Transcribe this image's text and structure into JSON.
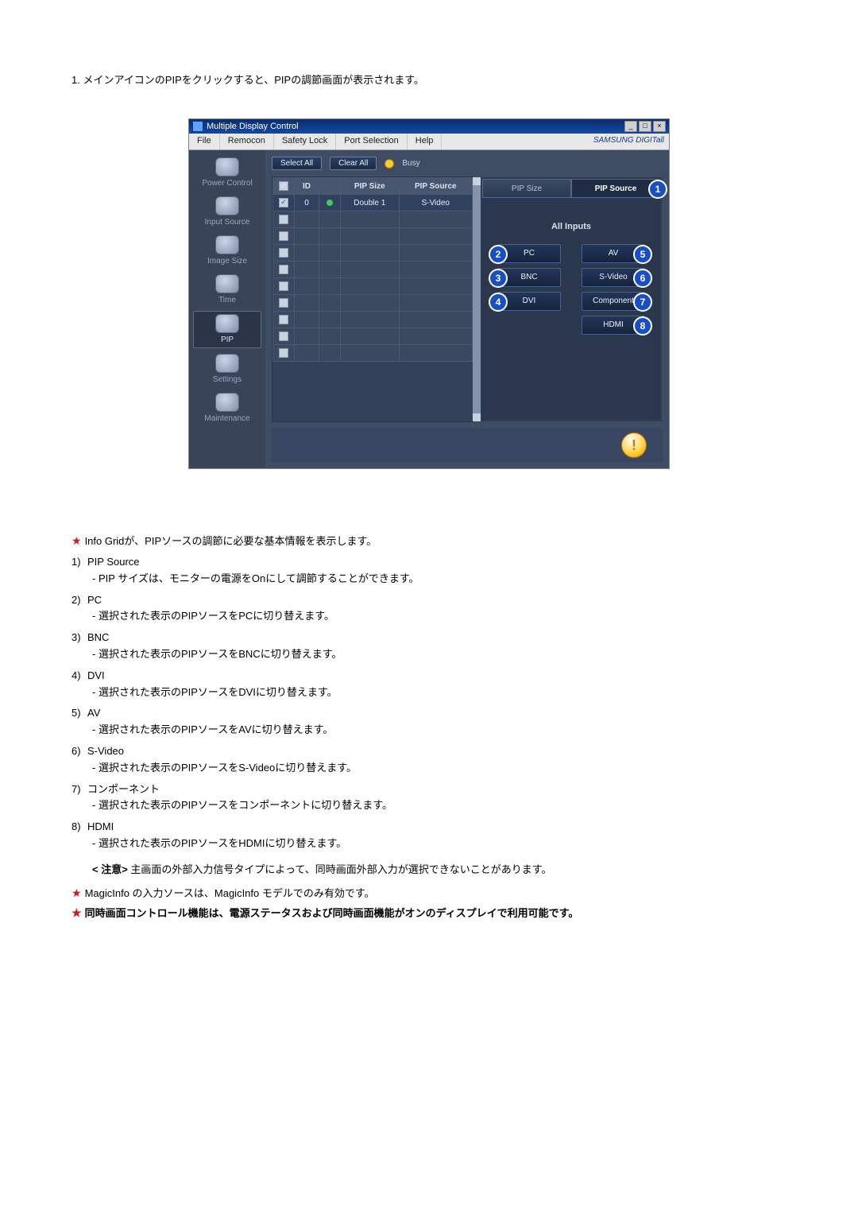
{
  "intro": "1.  メインアイコンのPIPをクリックすると、PIPの調節画面が表示されます。",
  "window": {
    "title": "Multiple Display Control",
    "menu": [
      "File",
      "Remocon",
      "Safety Lock",
      "Port Selection",
      "Help"
    ],
    "brand": "SAMSUNG DIGITall",
    "sidebar": [
      {
        "label": "Power Control"
      },
      {
        "label": "Input Source"
      },
      {
        "label": "Image Size"
      },
      {
        "label": "Time"
      },
      {
        "label": "PIP",
        "active": true
      },
      {
        "label": "Settings"
      },
      {
        "label": "Maintenance"
      }
    ],
    "toolbar": {
      "select_all": "Select All",
      "clear_all": "Clear All",
      "busy": "Busy"
    },
    "grid": {
      "headers": {
        "sel": "",
        "id": "ID",
        "status": "",
        "pip_size": "PIP Size",
        "pip_source": "PIP Source"
      },
      "rows": [
        {
          "id": "0",
          "pip_size": "Double 1",
          "pip_source": "S-Video",
          "active": true
        }
      ],
      "blank_rows": 9
    },
    "panel": {
      "tabs": [
        {
          "label": "PIP Size",
          "callout": null
        },
        {
          "label": "PIP Source",
          "callout": "1",
          "active": true
        }
      ],
      "heading": "All Inputs",
      "left_col": [
        {
          "label": "PC",
          "callout": "2"
        },
        {
          "label": "BNC",
          "callout": "3"
        },
        {
          "label": "DVI",
          "callout": "4"
        }
      ],
      "right_col": [
        {
          "label": "AV",
          "callout": "5"
        },
        {
          "label": "S-Video",
          "callout": "6"
        },
        {
          "label": "Component",
          "callout": "7"
        },
        {
          "label": "HDMI",
          "callout": "8"
        }
      ]
    }
  },
  "desc_intro": "Info Gridが、PIPソースの調節に必要な基本情報を表示します。",
  "items": [
    {
      "num": "1)",
      "title": "PIP Source",
      "sub": "- PIP サイズは、モニターの電源をOnにして調節することができます。"
    },
    {
      "num": "2)",
      "title": "PC",
      "sub": "- 選択された表示のPIPソースをPCに切り替えます。"
    },
    {
      "num": "3)",
      "title": "BNC",
      "sub": "- 選択された表示のPIPソースをBNCに切り替えます。"
    },
    {
      "num": "4)",
      "title": "DVI",
      "sub": "- 選択された表示のPIPソースをDVIに切り替えます。"
    },
    {
      "num": "5)",
      "title": "AV",
      "sub": "- 選択された表示のPIPソースをAVに切り替えます。"
    },
    {
      "num": "6)",
      "title": "S-Video",
      "sub": "- 選択された表示のPIPソースをS-Videoに切り替えます。"
    },
    {
      "num": "7)",
      "title": "コンポーネント",
      "sub": "- 選択された表示のPIPソースをコンポーネントに切り替えます。"
    },
    {
      "num": "8)",
      "title": "HDMI",
      "sub": "- 選択された表示のPIPソースをHDMIに切り替えます。"
    }
  ],
  "caution_label": "< 注意>",
  "caution_text": "主画面の外部入力信号タイプによって、同時画面外部入力が選択できないことがあります。",
  "foot1": "MagicInfo の入力ソースは、MagicInfo モデルでのみ有効です。",
  "foot2": "同時画面コントロール機能は、電源ステータスおよび同時画面機能がオンのディスプレイで利用可能です。"
}
